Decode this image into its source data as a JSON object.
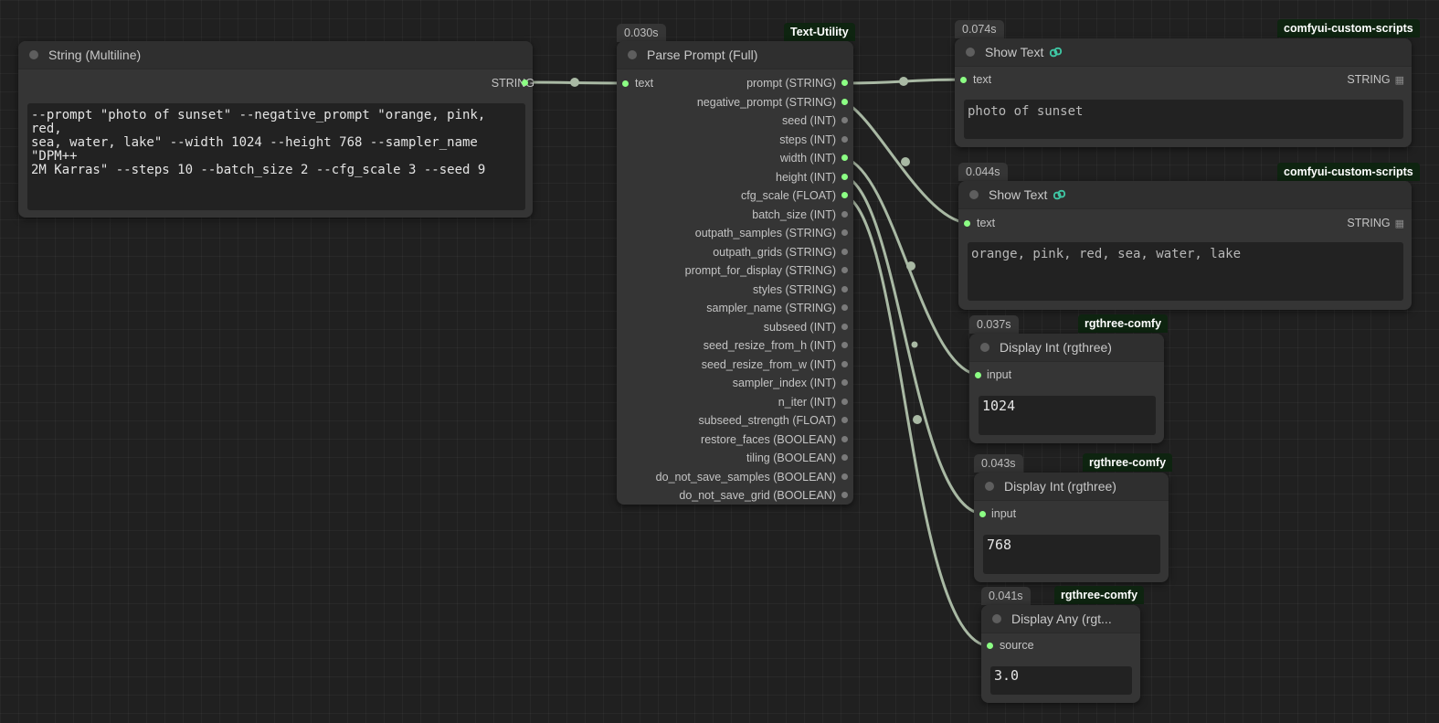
{
  "string_node": {
    "title": "String (Multiline)",
    "output_label": "STRING",
    "text": "--prompt \"photo of sunset\" --negative_prompt \"orange, pink, red,\nsea, water, lake\" --width 1024 --height 768 --sampler_name \"DPM++\n2M Karras\" --steps 10 --batch_size 2 --cfg_scale 3 --seed 9"
  },
  "parse_node": {
    "timing": "0.030s",
    "badge": "Text-Utility",
    "title": "Parse Prompt (Full)",
    "input_label": "text",
    "outputs": [
      "prompt (STRING)",
      "negative_prompt (STRING)",
      "seed (INT)",
      "steps (INT)",
      "width (INT)",
      "height (INT)",
      "cfg_scale (FLOAT)",
      "batch_size (INT)",
      "outpath_samples (STRING)",
      "outpath_grids (STRING)",
      "prompt_for_display (STRING)",
      "styles (STRING)",
      "sampler_name (STRING)",
      "subseed (INT)",
      "seed_resize_from_h (INT)",
      "seed_resize_from_w (INT)",
      "sampler_index (INT)",
      "n_iter (INT)",
      "subseed_strength (FLOAT)",
      "restore_faces (BOOLEAN)",
      "tiling (BOOLEAN)",
      "do_not_save_samples (BOOLEAN)",
      "do_not_save_grid (BOOLEAN)"
    ]
  },
  "show_text_1": {
    "timing": "0.074s",
    "badge": "comfyui-custom-scripts",
    "title": "Show Text",
    "input_label": "text",
    "output_label": "STRING",
    "value": "photo of sunset"
  },
  "show_text_2": {
    "timing": "0.044s",
    "badge": "comfyui-custom-scripts",
    "title": "Show Text",
    "input_label": "text",
    "output_label": "STRING",
    "value": "orange, pink, red, sea, water, lake"
  },
  "display_int_1": {
    "timing": "0.037s",
    "badge": "rgthree-comfy",
    "title": "Display Int (rgthree)",
    "input_label": "input",
    "value": "1024"
  },
  "display_int_2": {
    "timing": "0.043s",
    "badge": "rgthree-comfy",
    "title": "Display Int (rgthree)",
    "input_label": "input",
    "value": "768"
  },
  "display_any": {
    "timing": "0.041s",
    "badge": "rgthree-comfy",
    "title": "Display Any (rgt...",
    "input_label": "source",
    "value": "3.0"
  },
  "colors": {
    "canvas": "#202020",
    "node": "#353535",
    "slot_connected": "#8cff84",
    "link": "#a9b9a4",
    "badge_bg": "#0e2410"
  }
}
